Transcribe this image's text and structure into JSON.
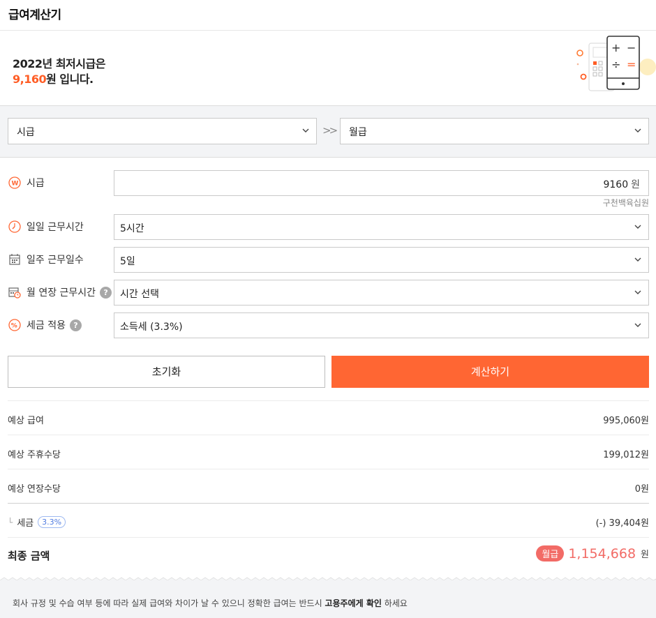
{
  "header": {
    "title": "급여계산기"
  },
  "hero": {
    "line1": "2022년 최저시급은",
    "wage": "9,160",
    "line2_suffix": "원 입니다."
  },
  "converter": {
    "from": "시급",
    "to": "월급",
    "arrows": ">>"
  },
  "form": {
    "hourly": {
      "label": "시급",
      "value": "9160",
      "unit": "원",
      "hint": "구천백육십원"
    },
    "daily_hours": {
      "label": "일일 근무시간",
      "value": "5시간"
    },
    "weekly_days": {
      "label": "일주 근무일수",
      "value": "5일"
    },
    "overtime": {
      "label": "월 연장 근무시간",
      "value": "시간 선택",
      "help": "?"
    },
    "tax": {
      "label": "세금 적용",
      "value": "소득세 (3.3%)",
      "help": "?"
    }
  },
  "buttons": {
    "reset": "초기화",
    "calculate": "계산하기"
  },
  "results": {
    "expected_pay": {
      "label": "예상 급여",
      "value": "995,060원"
    },
    "weekly_allowance": {
      "label": "예상 주휴수당",
      "value": "199,012원"
    },
    "overtime_pay": {
      "label": "예상 연장수당",
      "value": "0원"
    },
    "tax": {
      "tree": "└",
      "label": "세금",
      "rate": "3.3%",
      "value": "(-) 39,404원"
    },
    "final": {
      "label": "최종 금액",
      "badge": "월급",
      "amount": "1,154,668",
      "unit": "원"
    }
  },
  "notice": {
    "text_before": "회사 규정 및 수습 여부 등에 따라 실제 급여와 차이가 날 수 있으니 정확한 급여는 반드시 ",
    "bold": "고용주에게 확인",
    "text_after": " 하세요"
  },
  "colors": {
    "accent": "#ff6633",
    "final_amount": "#f26b66",
    "pill": "#4f7be0"
  }
}
